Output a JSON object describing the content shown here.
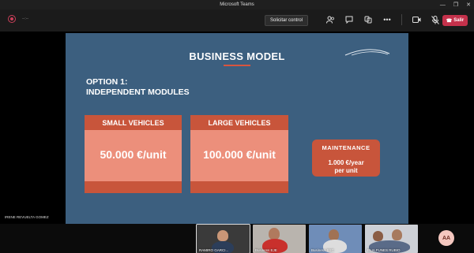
{
  "window": {
    "title": "Microsoft Teams"
  },
  "toolbar": {
    "timer": "--:--",
    "control_button": "Solicitar control",
    "leave_button": "Salir"
  },
  "slide": {
    "title": "BUSINESS MODEL",
    "option_line1": "OPTION 1:",
    "option_line2": "INDEPENDENT MODULES",
    "small": {
      "title": "SMALL VEHICLES",
      "price": "50.000 €/unit"
    },
    "large": {
      "title": "LARGE VEHICLES",
      "price": "100.000 €/unit"
    },
    "maintenance": {
      "title": "MAINTENANCE",
      "value_line1": "1.000 €/year",
      "value_line2": "per unit"
    }
  },
  "presenter": {
    "name": "IRENE REVUELTA GOMEZ"
  },
  "participants": [
    {
      "name": "RAMIRO GARCI..."
    },
    {
      "name": "Business EJE"
    },
    {
      "name": "Business SYC"
    },
    {
      "name": "ELIA FUNES RUBIO"
    }
  ],
  "avatar": {
    "initials": "AA"
  },
  "colors": {
    "slide_bg": "#3c5f7f",
    "accent": "#c8553b",
    "card_body": "#ec8f7b",
    "leave": "#c4314b"
  }
}
